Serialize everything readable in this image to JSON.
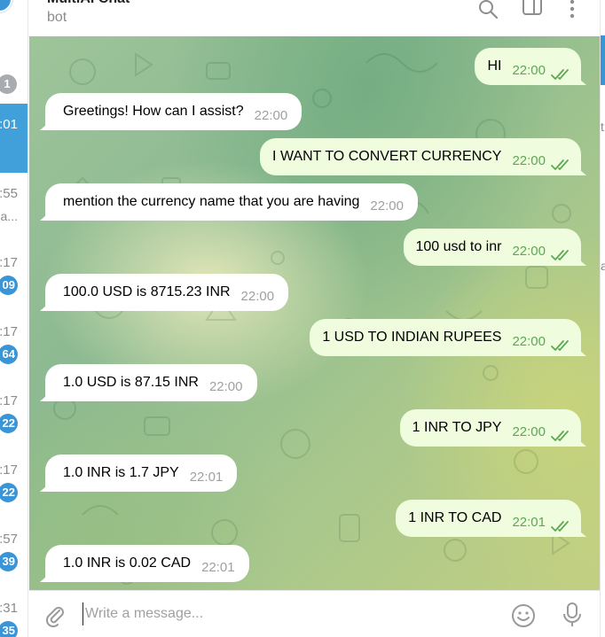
{
  "chat_header": {
    "title": "MultiAI Chat",
    "subtitle": "bot"
  },
  "chat_list_strip": {
    "top_badge": "1",
    "items": [
      {
        "time": ":01",
        "snippet": "",
        "badge": "",
        "active": true
      },
      {
        "time": ":55",
        "snippet": "a...",
        "badge": "",
        "active": false
      },
      {
        "time": ":17",
        "snippet": "",
        "badge": "09",
        "active": false
      },
      {
        "time": ":17",
        "snippet": "",
        "badge": "64",
        "active": false
      },
      {
        "time": ":17",
        "snippet": "",
        "badge": "22",
        "active": false
      },
      {
        "time": ":17",
        "snippet": "",
        "badge": "22",
        "active": false
      },
      {
        "time": ":57",
        "snippet": "",
        "badge": "39",
        "active": false
      },
      {
        "time": ":31",
        "snippet": "",
        "badge": "35",
        "active": false
      }
    ]
  },
  "messages": [
    {
      "dir": "out",
      "text": "HI",
      "time": "22:00"
    },
    {
      "dir": "in",
      "text": "Greetings! How can I assist?",
      "time": "22:00"
    },
    {
      "dir": "out",
      "text": "I WANT TO CONVERT CURRENCY",
      "time": "22:00"
    },
    {
      "dir": "in",
      "text": "mention the currency name that you are having",
      "time": "22:00"
    },
    {
      "dir": "out",
      "text": "100 usd to inr",
      "time": "22:00"
    },
    {
      "dir": "in",
      "text": "100.0 USD is 8715.23 INR",
      "time": "22:00"
    },
    {
      "dir": "out",
      "text": "1 USD TO INDIAN RUPEES",
      "time": "22:00"
    },
    {
      "dir": "in",
      "text": "1.0 USD is 87.15 INR",
      "time": "22:00"
    },
    {
      "dir": "out",
      "text": "1 INR TO JPY",
      "time": "22:00"
    },
    {
      "dir": "in",
      "text": "1.0 INR is 1.7 JPY",
      "time": "22:01"
    },
    {
      "dir": "out",
      "text": "1 INR TO CAD",
      "time": "22:01"
    },
    {
      "dir": "in",
      "text": "1.0 INR is 0.02 CAD",
      "time": "22:01"
    }
  ],
  "composer": {
    "placeholder": "Write a message..."
  },
  "icons": {
    "search": "search-icon",
    "sidebar": "sidebar-toggle-icon",
    "more": "more-vertical-icon",
    "attach": "paperclip-icon",
    "emoji": "emoji-icon",
    "mic": "microphone-icon",
    "read": "double-check-icon"
  },
  "colors": {
    "accent": "#419fd9",
    "incoming_bubble": "#ffffff",
    "outgoing_bubble": "#effdde",
    "outgoing_time": "#5ca853",
    "incoming_time": "#a0a0a0"
  },
  "right_edge": {
    "fragments": [
      "t",
      "a"
    ]
  }
}
